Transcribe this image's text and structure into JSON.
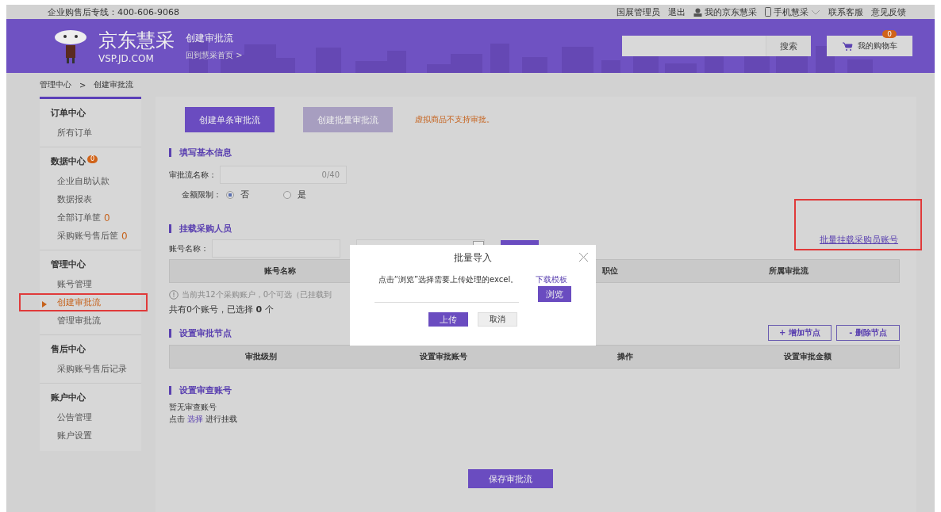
{
  "top_bar": {
    "hotline": "企业购售后专线：400-606-9068",
    "links": [
      {
        "label": "国展管理员",
        "kind": "text"
      },
      {
        "label": "退出",
        "kind": "text"
      },
      {
        "label": "我的京东慧采",
        "kind": "user"
      },
      {
        "label": "手机慧采",
        "kind": "mobile"
      },
      {
        "label": "联系客服",
        "kind": "text"
      },
      {
        "label": "意见反馈",
        "kind": "text"
      }
    ]
  },
  "header": {
    "logo_title": "京东慧采",
    "logo_subtitle": "VSP.JD.COM",
    "page_title": "创建审批流",
    "back_link": "回到慧采首页 >",
    "search_button": "搜索",
    "cart": {
      "label": "我的购物车",
      "count": "0"
    }
  },
  "breadcrumb": {
    "items": [
      "管理中心",
      "创建审批流"
    ],
    "separator": ">"
  },
  "sidebar": {
    "groups": [
      {
        "title": "订单中心",
        "items": [
          {
            "label": "所有订单",
            "selected": false,
            "highlighted": false
          }
        ]
      },
      {
        "title": "数据中心",
        "badge": "0",
        "items": [
          {
            "label": "企业自助认款",
            "selected": false,
            "highlighted": false
          },
          {
            "label": "数据报表",
            "selected": false,
            "highlighted": false
          },
          {
            "label": "全部订单筐",
            "count": "0",
            "selected": false,
            "highlighted": false
          },
          {
            "label": "采购账号售后筐",
            "count": "0",
            "selected": false,
            "highlighted": false
          }
        ]
      },
      {
        "title": "管理中心",
        "items": [
          {
            "label": "账号管理",
            "selected": false,
            "highlighted": false
          },
          {
            "label": "创建审批流",
            "selected": true,
            "highlighted": true
          },
          {
            "label": "管理审批流",
            "selected": false,
            "highlighted": false
          }
        ]
      },
      {
        "title": "售后中心",
        "items": [
          {
            "label": "采购账号售后记录",
            "selected": false,
            "highlighted": false
          }
        ]
      },
      {
        "title": "账户中心",
        "items": [
          {
            "label": "公告管理",
            "selected": false,
            "highlighted": false
          },
          {
            "label": "账户设置",
            "selected": false,
            "highlighted": false
          }
        ]
      }
    ]
  },
  "mode_tabs": [
    {
      "label": "创建单条审批流",
      "selected": true
    },
    {
      "label": "创建批量审批流",
      "selected": false
    }
  ],
  "notice": "虚拟商品不支持审批。",
  "basic_info": {
    "heading": "填写基本信息",
    "name_label": "审批流名称：",
    "name_counter": "0/40",
    "amount_label": "金额限制：",
    "options": [
      {
        "label": "否",
        "selected": true
      },
      {
        "label": "是",
        "selected": false
      }
    ]
  },
  "buyers": {
    "heading": "挂载采购人员",
    "batch_link": {
      "label": "批量挂载采购员账号",
      "highlighted": true
    },
    "account_label": "账号名称：",
    "columns": [
      "账号名称",
      "职位",
      "所属审批流"
    ],
    "note": "当前共12个采购账户，0个可选（已挂载到",
    "summary": "共有0个账号，已选择 **0** 个"
  },
  "nodes": {
    "heading": "设置审批节点",
    "add_button": "+ 增加节点",
    "remove_button": "- 删除节点",
    "columns": [
      "审批级别",
      "设置审批账号",
      "操作",
      "设置审批金额"
    ]
  },
  "reviewer": {
    "heading": "设置审查账号",
    "empty_text": "暂无审查账号",
    "hint_prefix": "点击",
    "hint_link": "选择",
    "hint_suffix": "进行挂载"
  },
  "save_button": "保存审批流",
  "modal": {
    "title": "批量导入",
    "instruction": "点击“浏览”选择需要上传处理的excel。",
    "template_link": "下载模板",
    "browse_button": "浏览",
    "upload_button": "上传",
    "cancel_button": "取消"
  }
}
